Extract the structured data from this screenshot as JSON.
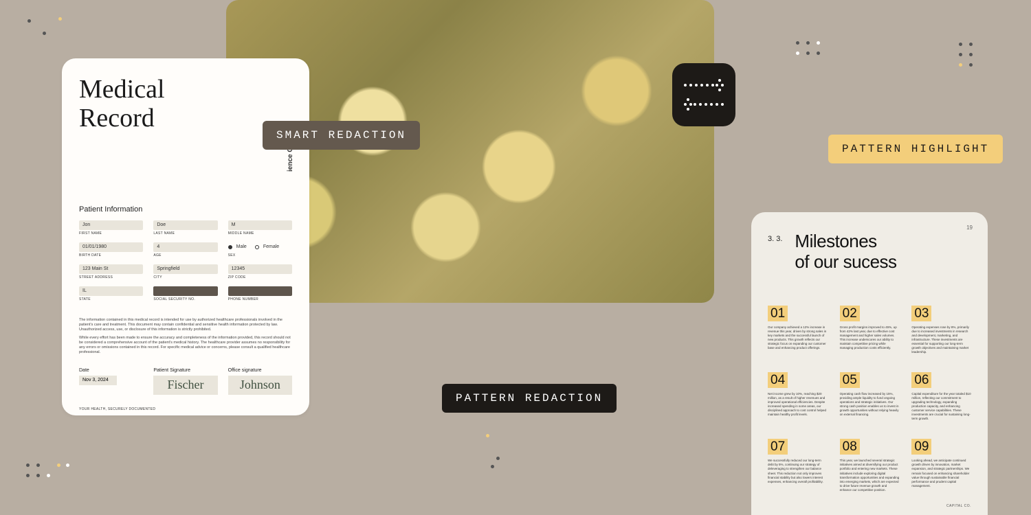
{
  "pills": {
    "smart": "SMART REDACTION",
    "pattern_redaction": "PATTERN REDACTION",
    "pattern_highlight": "PATTERN HIGHLIGHT"
  },
  "med": {
    "title_l1": "Medical",
    "title_l2": "Record",
    "brand": "ience Co.",
    "section": "Patient Information",
    "fields": {
      "first_name": {
        "value": "Jon",
        "label": "FIRST NAME"
      },
      "last_name": {
        "value": "Doe",
        "label": "LAST NAME"
      },
      "middle": {
        "value": "M",
        "label": "MIDDLE NAME"
      },
      "birth": {
        "value": "01/01/1980",
        "label": "BIRTH DATE"
      },
      "age": {
        "value": "4",
        "label": "AGE"
      },
      "sex": {
        "male": "Male",
        "female": "Female",
        "label": "SEX"
      },
      "street": {
        "value": "123 Main St",
        "label": "STREET ADDRESS"
      },
      "city": {
        "value": "Springfield",
        "label": "CITY"
      },
      "zip": {
        "value": "12345",
        "label": "ZIP CODE"
      },
      "state": {
        "value": "IL",
        "label": "STATE"
      },
      "ssn": {
        "value": "",
        "label": "SOCIAL SECURITY NO."
      },
      "phone": {
        "value": "",
        "label": "PHONE NUMBER"
      }
    },
    "disclaimer_p1": "The information contained in this medical record is intended for use by authorized healthcare professionals involved in the patient's care and treatment. This document may contain confidential and sensitive health information protected by law. Unauthorized access, use, or disclosure of this information is strictly prohibited.",
    "disclaimer_p2": "While every effort has been made to ensure the accuracy and completeness of the information provided, this record should not be considered a comprehensive account of the patient's medical history. The healthcare provider assumes no responsibility for any errors or omissions contained in this record. For specific medical advice or concerns, please consult a qualified healthcare professional.",
    "sig": {
      "date_label": "Date",
      "date_value": "Nov 3, 2024",
      "patient_label": "Patient Signature",
      "patient_sig": "Fischer",
      "office_label": "Office signature",
      "office_sig": "Johnson"
    },
    "footer": "YOUR HEALTH, SECURELY DOCUMENTED"
  },
  "mile": {
    "section_no": "3. 3.",
    "title_l1": "Milestones",
    "title_l2": "of our sucess",
    "page": "19",
    "footer": "CAPITAL CO.",
    "items": [
      {
        "n": "01",
        "t": "Our company achieved a 12% increase in revenue this year, driven by strong sales in key markets and the successful launch of new products. This growth reflects our strategic focus on expanding our customer base and enhancing product offerings."
      },
      {
        "n": "02",
        "t": "Gross profit margins improved to 45%, up from 42% last year, due to effective cost management and higher sales volumes. This increase underscores our ability to maintain competitive pricing while managing production costs efficiently."
      },
      {
        "n": "03",
        "t": "Operating expenses rose by 8%, primarily due to increased investments in research and development, marketing, and infrastructure. These investments are essential for supporting our long-term growth objectives and maintaining market leadership."
      },
      {
        "n": "04",
        "t": "Net income grew by 10%, reaching $20 million, as a result of higher revenues and improved operational efficiencies. Despite increased spending in some areas, our disciplined approach to cost control helped maintain healthy profit levels."
      },
      {
        "n": "05",
        "t": "Operating cash flow increased by 15%, providing ample liquidity to fund ongoing operations and strategic initiatives. Our strong cash position enables us to invest in growth opportunities without relying heavily on external financing."
      },
      {
        "n": "06",
        "t": "Capital expenditure for the year totaled $10 million, reflecting our commitment to upgrading technology, expanding production capacity, and enhancing customer service capabilities. These investments are crucial for sustaining long-term growth."
      },
      {
        "n": "07",
        "t": "We successfully reduced our long-term debt by 5%, continuing our strategy of deleveraging to strengthen our balance sheet. This reduction not only improves financial stability but also lowers interest expenses, enhancing overall profitability."
      },
      {
        "n": "08",
        "t": "This year, we launched several strategic initiatives aimed at diversifying our product portfolio and entering new markets. These initiatives include exploring digital transformation opportunities and expanding into emerging markets, which are expected to drive future revenue growth and enhance our competitive position."
      },
      {
        "n": "09",
        "t": "Looking ahead, we anticipate continued growth driven by innovation, market expansion, and strategic partnerships. We remain focused on enhancing shareholder value through sustainable financial performance and prudent capital management."
      }
    ]
  }
}
